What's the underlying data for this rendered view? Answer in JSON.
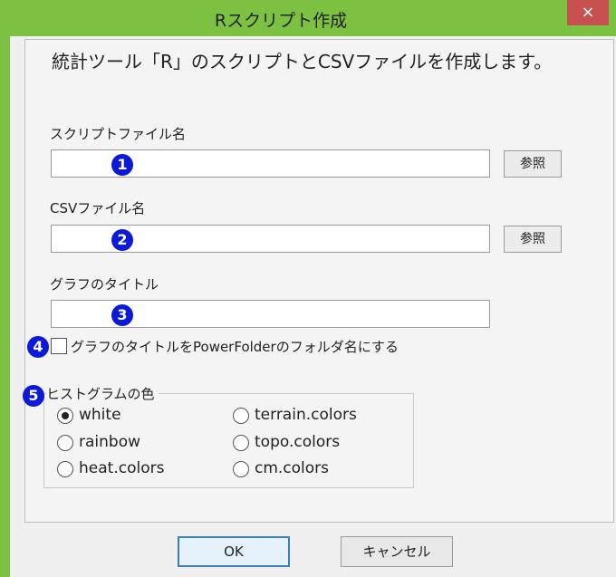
{
  "window": {
    "title": "Rスクリプト作成",
    "close_label": "×"
  },
  "heading": "統計ツール「R」のスクリプトとCSVファイルを作成します。",
  "fields": {
    "script": {
      "label": "スクリプトファイル名",
      "value": "",
      "badge": "1",
      "ref_label": "参照"
    },
    "csv": {
      "label": "CSVファイル名",
      "value": "",
      "badge": "2",
      "ref_label": "参照"
    },
    "graph_title": {
      "label": "グラフのタイトル",
      "value": "",
      "badge": "3"
    }
  },
  "checkbox": {
    "badge": "4",
    "label": "グラフのタイトルをPowerFolderのフォルダ名にする",
    "checked": false
  },
  "colors": {
    "badge": "5",
    "label": "ヒストグラムの色",
    "options": [
      "white",
      "terrain.colors",
      "rainbow",
      "topo.colors",
      "heat.colors",
      "cm.colors"
    ],
    "selected": "white"
  },
  "buttons": {
    "ok": "OK",
    "cancel": "キャンセル"
  },
  "palette": {
    "title_bar": "#7dc142",
    "badge": "#0b19d8",
    "close": "#c75050"
  }
}
